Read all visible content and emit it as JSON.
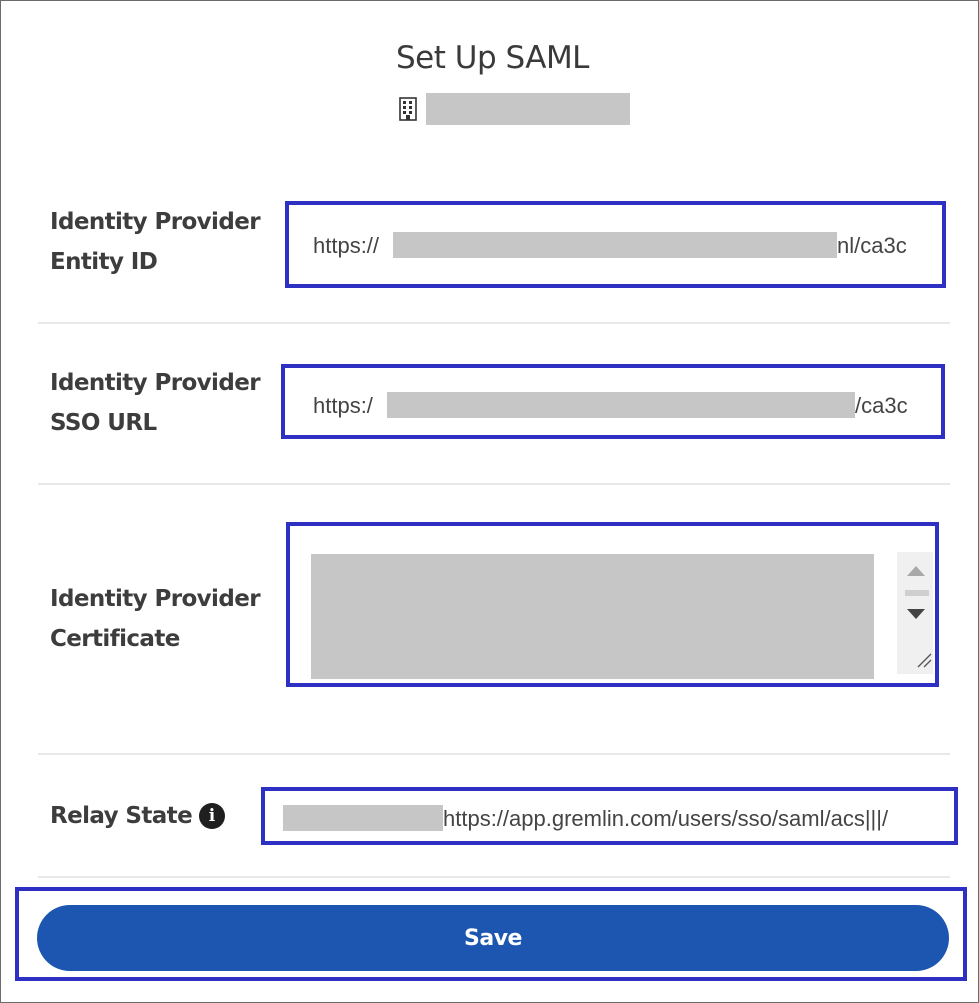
{
  "header": {
    "title": "Set Up SAML",
    "org_icon": "building-icon"
  },
  "fields": {
    "entity_id": {
      "label_line1": "Identity Provider",
      "label_line2": "Entity ID",
      "value_prefix": "https://",
      "value_suffix": "nl/ca3c"
    },
    "sso_url": {
      "label_line1": "Identity Provider",
      "label_line2": "SSO URL",
      "value_prefix": "https:/",
      "value_suffix": "/ca3c"
    },
    "certificate": {
      "label_line1": "Identity Provider",
      "label_line2": "Certificate"
    },
    "relay_state": {
      "label": "Relay State",
      "info_icon": "info-icon",
      "info_glyph": "i",
      "value_suffix": "https://app.gremlin.com/users/sso/saml/acs|||/"
    }
  },
  "actions": {
    "save_label": "Save"
  },
  "colors": {
    "highlight": "#2e30c4",
    "button": "#1c56b0",
    "redaction": "#c6c6c6"
  }
}
